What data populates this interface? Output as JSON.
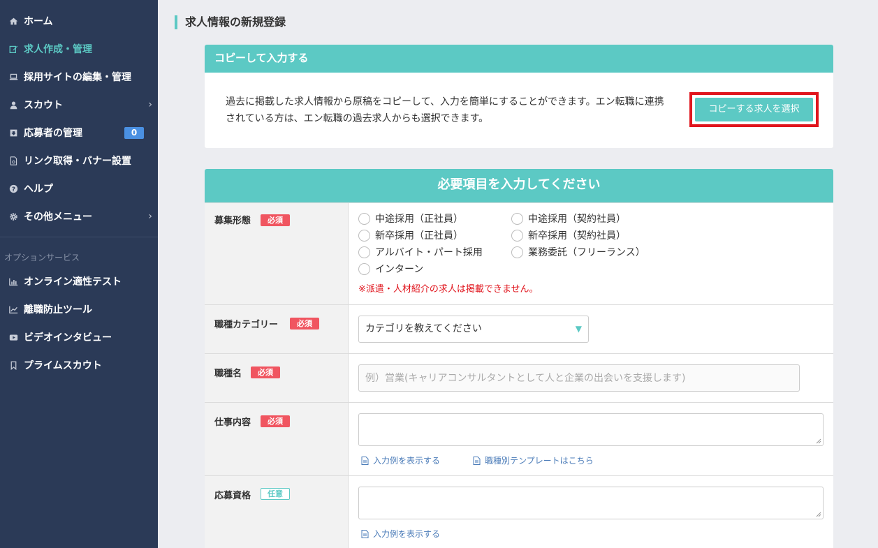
{
  "sidebar": {
    "items": [
      {
        "label": "ホーム",
        "icon": "home-icon"
      },
      {
        "label": "求人作成・管理",
        "icon": "edit-icon"
      },
      {
        "label": "採用サイトの編集・管理",
        "icon": "laptop-icon"
      },
      {
        "label": "スカウト",
        "icon": "user-icon"
      },
      {
        "label": "応募者の管理",
        "icon": "inbox-icon",
        "badge": "0"
      },
      {
        "label": "リンク取得・バナー設置",
        "icon": "file-link-icon"
      },
      {
        "label": "ヘルプ",
        "icon": "help-icon"
      },
      {
        "label": "その他メニュー",
        "icon": "gear-icon"
      }
    ],
    "section_label": "オプションサービス",
    "option_items": [
      {
        "label": "オンライン適性テスト",
        "icon": "bar-chart-icon"
      },
      {
        "label": "離職防止ツール",
        "icon": "line-chart-icon"
      },
      {
        "label": "ビデオインタビュー",
        "icon": "video-icon"
      },
      {
        "label": "プライムスカウト",
        "icon": "bookmark-icon"
      }
    ],
    "colors": {
      "background": "#2b3a57",
      "active": "#5cc9c4",
      "badge": "#4a90e2"
    }
  },
  "main": {
    "page_title": "求人情報の新規登録",
    "copy_card": {
      "header": "コピーして入力する",
      "description": "過去に掲載した求人情報から原稿をコピーして、入力を簡単にすることができます。エン転職に連携されている方は、エン転職の過去求人からも選択できます。",
      "button_label": "コピーする求人を選択"
    },
    "form": {
      "header": "必要項目を入力してください",
      "required_tag": "必須",
      "optional_tag": "任意",
      "recruitment_type": {
        "label": "募集形態",
        "options": [
          "中途採用（正社員）",
          "中途採用（契約社員）",
          "新卒採用（正社員）",
          "新卒採用（契約社員）",
          "アルバイト・パート採用",
          "業務委託（フリーランス）",
          "インターン"
        ],
        "notice": "※派遣・人材紹介の求人は掲載できません。"
      },
      "job_category": {
        "label": "職種カテゴリー",
        "select_value": "カテゴリを教えてください"
      },
      "job_title": {
        "label": "職種名",
        "placeholder": "例）営業(キャリアコンサルタントとして人と企業の出会いを支援します)"
      },
      "job_description": {
        "label": "仕事内容",
        "link_example": "入力例を表示する",
        "link_template": "職種別テンプレートはこちら"
      },
      "qualifications": {
        "label": "応募資格",
        "link_example": "入力例を表示する"
      }
    },
    "colors": {
      "accent": "#5cc9c4",
      "required": "#f05560",
      "highlight_border": "#e0151d",
      "link": "#4a7bb8"
    }
  }
}
